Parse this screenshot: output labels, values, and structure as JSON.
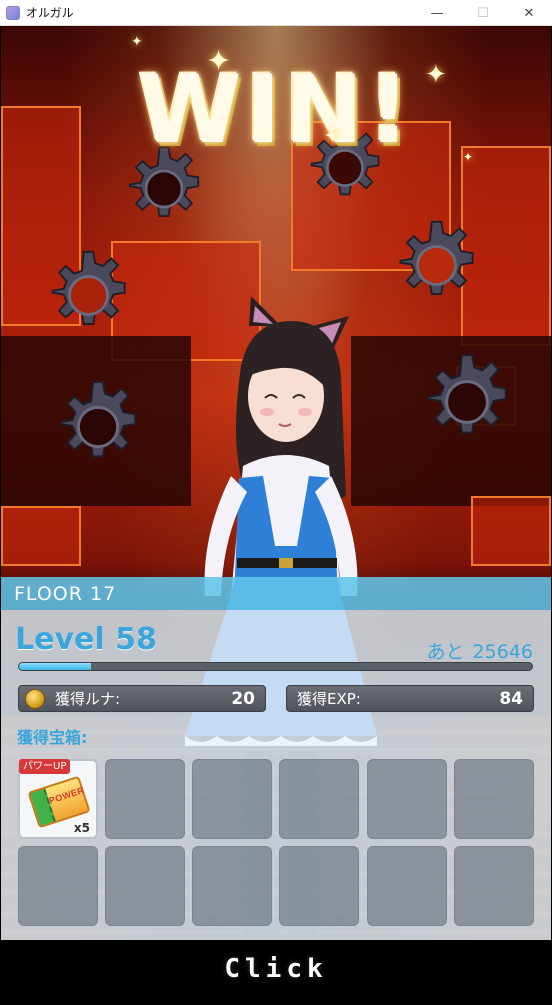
{
  "window": {
    "title": "オルガル",
    "minimize_glyph": "—",
    "maximize_glyph": "☐",
    "close_glyph": "✕"
  },
  "banner": {
    "text": "WIN!"
  },
  "result": {
    "floor_label": "FLOOR 17",
    "level_label": "Level 58",
    "remaining_label": "あと",
    "remaining_value": "25646",
    "exp_progress": 0.14,
    "luna_label": "獲得ルナ:",
    "luna_value": "20",
    "exp_label": "獲得EXP:",
    "exp_value": "84",
    "chest_title": "獲得宝箱:",
    "items": [
      {
        "tag": "パワーUP",
        "count": "x5",
        "icon": "power-up-ticket-icon",
        "ticket_text": "POWER"
      }
    ],
    "empty_slots": 11
  },
  "footer": {
    "click_text": "Click"
  },
  "colors": {
    "accent": "#3aa6dc",
    "floor_bar": "#62c4e8",
    "tag_red": "#d7383a"
  }
}
